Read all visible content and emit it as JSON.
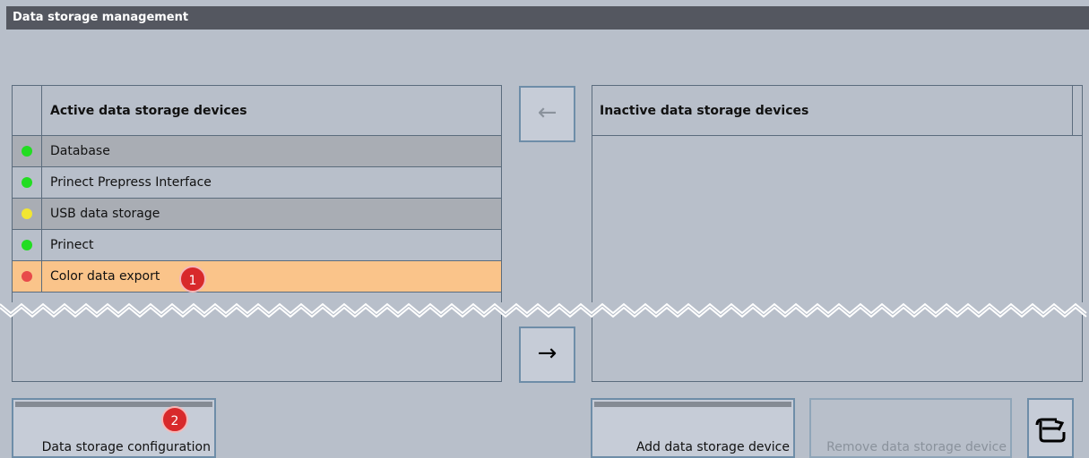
{
  "window": {
    "title": "Data storage management"
  },
  "active_panel": {
    "header": "Active data storage devices",
    "rows": [
      {
        "label": "Database",
        "status_color": "#22dd22",
        "style": "alt"
      },
      {
        "label": "Prinect Prepress Interface",
        "status_color": "#22dd22",
        "style": "plain"
      },
      {
        "label": "USB data storage",
        "status_color": "#f2e632",
        "style": "alt"
      },
      {
        "label": "Prinect",
        "status_color": "#22dd22",
        "style": "plain"
      },
      {
        "label": "Color data export",
        "status_color": "#e84a4a",
        "style": "selected"
      }
    ]
  },
  "inactive_panel": {
    "header": "Inactive data storage devices"
  },
  "buttons": {
    "move_to_active": "←",
    "move_to_inactive": "→",
    "config": "Data storage configuration",
    "add": "Add data storage device",
    "remove": "Remove data storage device",
    "exit_icon": "exit-icon"
  },
  "callouts": {
    "one": "1",
    "two": "2"
  },
  "colors": {
    "selected_row": "#fac48a",
    "badge": "#d8292b",
    "titlebar": "#545760"
  }
}
